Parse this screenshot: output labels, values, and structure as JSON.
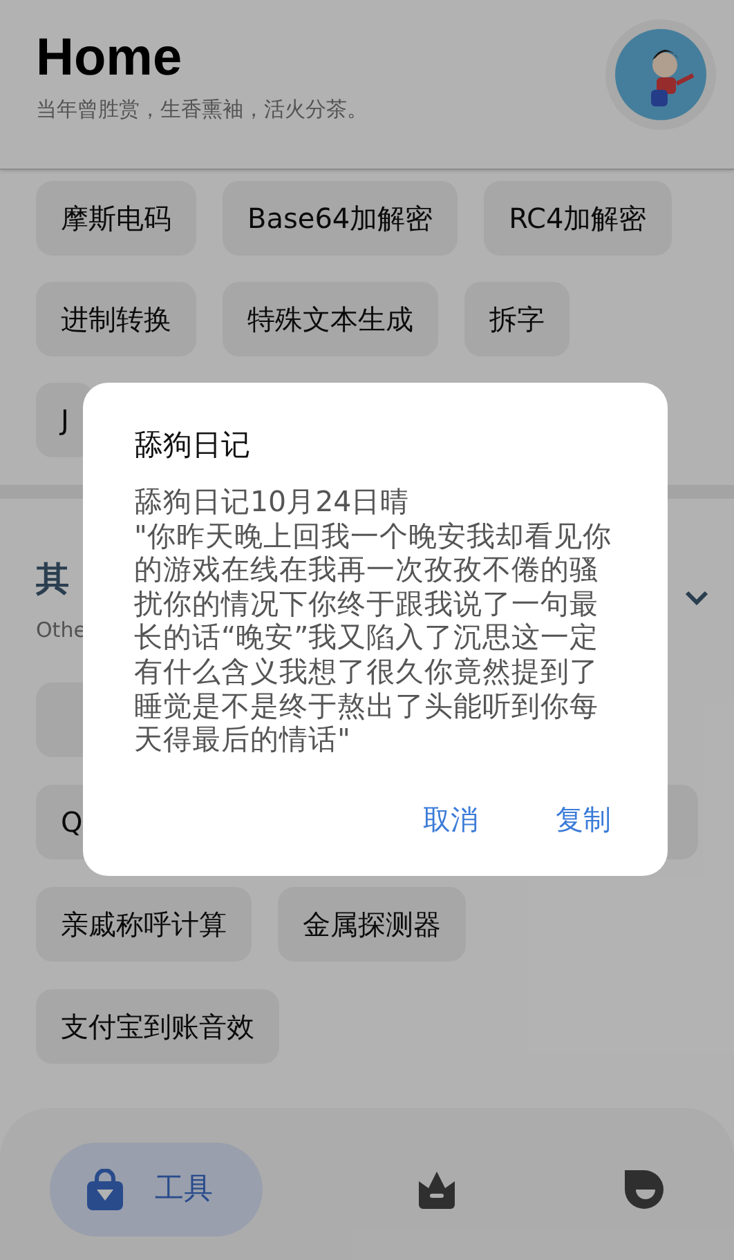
{
  "header": {
    "title": "Home",
    "subtitle": "当年曾胜赏，生香熏袖，活火分茶。"
  },
  "tool_rows": [
    [
      "摩斯电码",
      "Base64加解密",
      "RC4加解密"
    ],
    [
      "进制转换",
      "特殊文本生成",
      "拆字"
    ],
    [
      "J"
    ]
  ],
  "section": {
    "title": "其",
    "subtitle": "Othe",
    "expanded": true
  },
  "other_rows": [
    [
      ""
    ],
    [
      "Q",
      ""
    ],
    [
      "亲戚称呼计算",
      "金属探测器"
    ],
    [
      "支付宝到账音效"
    ]
  ],
  "dialog": {
    "title": "舔狗日记",
    "body": "舔狗日记10月24日晴\n\"你昨天晚上回我一个晚安我却看见你的游戏在线在我再一次孜孜不倦的骚扰你的情况下你终于跟我说了一句最长的话“晚安”我又陷入了沉思这一定有什么含义我想了很久你竟然提到了睡觉是不是终于熬出了头能听到你每天得最后的情话\"",
    "buttons": [
      "取消",
      "复制"
    ]
  },
  "nav": [
    {
      "kind": "bag",
      "label": "工具",
      "selected": true
    },
    {
      "kind": "crown",
      "selected": false
    },
    {
      "kind": "face",
      "selected": false
    }
  ]
}
